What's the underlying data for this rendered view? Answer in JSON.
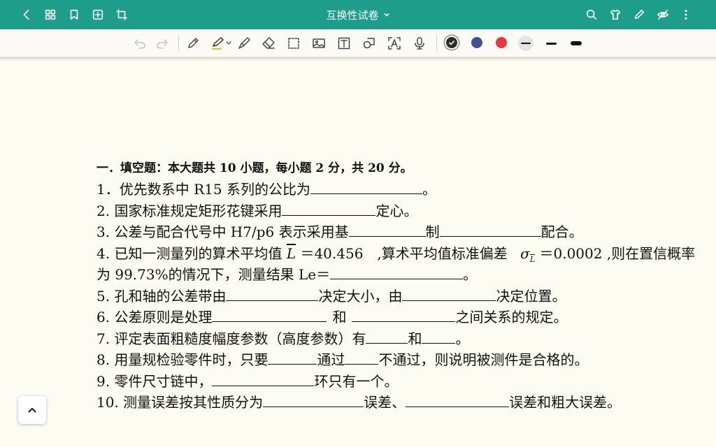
{
  "app_bar": {
    "title": "互换性试卷",
    "left_icons": [
      "back-icon",
      "grid-icon",
      "bookmark-icon",
      "add-page-icon",
      "crop-icon"
    ],
    "right_icons": [
      "search-icon",
      "shirt-icon",
      "pen-icon",
      "eye-off-icon",
      "more-icon"
    ],
    "bar_color": "#1e9e8a"
  },
  "toolbar": {
    "tools": [
      "undo-icon",
      "redo-icon",
      "pencil-icon",
      "highlighter-icon",
      "brush-icon",
      "eraser-icon",
      "lasso-select-icon",
      "image-icon",
      "text-icon",
      "shape-icon",
      "ocr-icon",
      "microphone-icon"
    ],
    "colors": [
      "#2b2b2b",
      "#3a5591",
      "#e8363d"
    ],
    "selected_color": "#2b2b2b",
    "stroke_widths": [
      "thin",
      "medium",
      "thick"
    ],
    "selected_stroke": "thin"
  },
  "document": {
    "heading": "一．填空题：本大题共 10 小题，每小题 2 分，共 20 分。",
    "q1": {
      "a": "1．优先数系中 R15 系列的公比为",
      "b": "。"
    },
    "q2": {
      "a": "2. 国家标准规定矩形花键采用",
      "b": "定心。"
    },
    "q3": {
      "a": "3. 公差与配合代号中 H7/p6 表示采用基",
      "b": "制",
      "c": "配合。"
    },
    "q4": {
      "a": "4. 已知一测量列的算术平均值",
      "symbol": "L",
      "b": "＝40.456　,算术平均值标准偏差",
      "sigma": "σ",
      "sub": "L",
      "c": "＝0.0002 ,则在置信概率"
    },
    "q4b": {
      "a": "为 99.73%的情况下，测量结果 Le＝",
      "b": "。"
    },
    "q5": {
      "a": "5.  孔和轴的公差带由",
      "b": "决定大小，由",
      "c": "决定位置。"
    },
    "q6": {
      "a": "6. 公差原则是处理",
      "b": "和",
      "c": "之间关系的规定。"
    },
    "q7": {
      "a": "7.  评定表面粗糙度幅度参数（高度参数）有",
      "b": "和",
      "c": "。"
    },
    "q8": {
      "a": "8.  用量规检验零件时，只要",
      "b": "通过",
      "c": "不通过，则说明被测件是合格的。"
    },
    "q9": {
      "a": "9.  零件尺寸链中，",
      "b": "环只有一个。"
    },
    "q10": {
      "a": "10. 测量误差按其性质分为",
      "b": "误差、",
      "c": "误差和粗大误差。"
    }
  }
}
